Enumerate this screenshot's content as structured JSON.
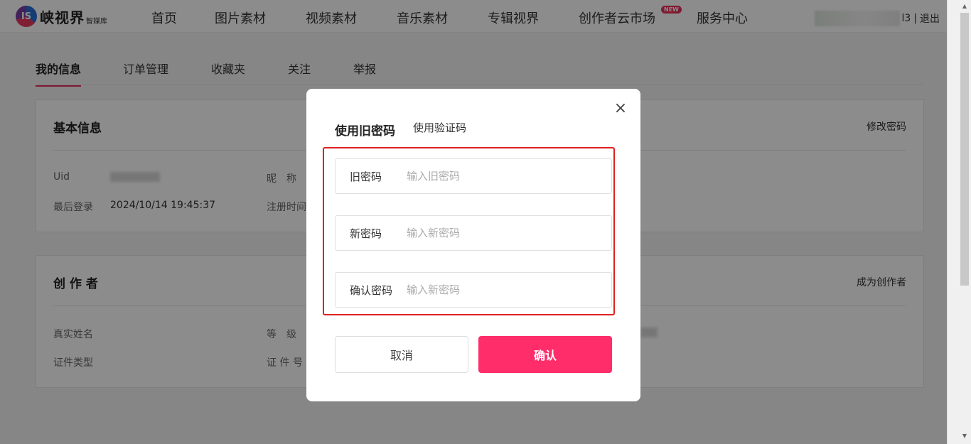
{
  "header": {
    "logo_text": "峡视界",
    "logo_sub": "智媒库",
    "nav": [
      {
        "label": "首页"
      },
      {
        "label": "图片素材"
      },
      {
        "label": "视频素材"
      },
      {
        "label": "音乐素材"
      },
      {
        "label": "专辑视界"
      },
      {
        "label": "创作者云市场",
        "badge": "NEW"
      },
      {
        "label": "服务中心"
      }
    ],
    "user_suffix": "l3",
    "separator": "|",
    "logout": "退出"
  },
  "tabs": [
    "我的信息",
    "订单管理",
    "收藏夹",
    "关注",
    "举报"
  ],
  "basic_info": {
    "title": "基本信息",
    "action": "修改密码",
    "uid_label": "Uid",
    "nickname_label": "昵　称",
    "last_login_label": "最后登录",
    "last_login_value": "2024/10/14 19:45:37",
    "register_time_label": "注册时间"
  },
  "creator": {
    "title": "创 作 者",
    "action": "成为创作者",
    "real_name_label": "真实姓名",
    "level_label": "等　级",
    "id_type_label": "证件类型",
    "id_number_label": "证 件 号"
  },
  "modal": {
    "tab_old": "使用旧密码",
    "tab_code": "使用验证码",
    "close": "×",
    "fields": [
      {
        "label": "旧密码",
        "placeholder": "输入旧密码"
      },
      {
        "label": "新密码",
        "placeholder": "输入新密码"
      },
      {
        "label": "确认密码",
        "placeholder": "输入新密码"
      }
    ],
    "cancel": "取消",
    "confirm": "确认"
  }
}
